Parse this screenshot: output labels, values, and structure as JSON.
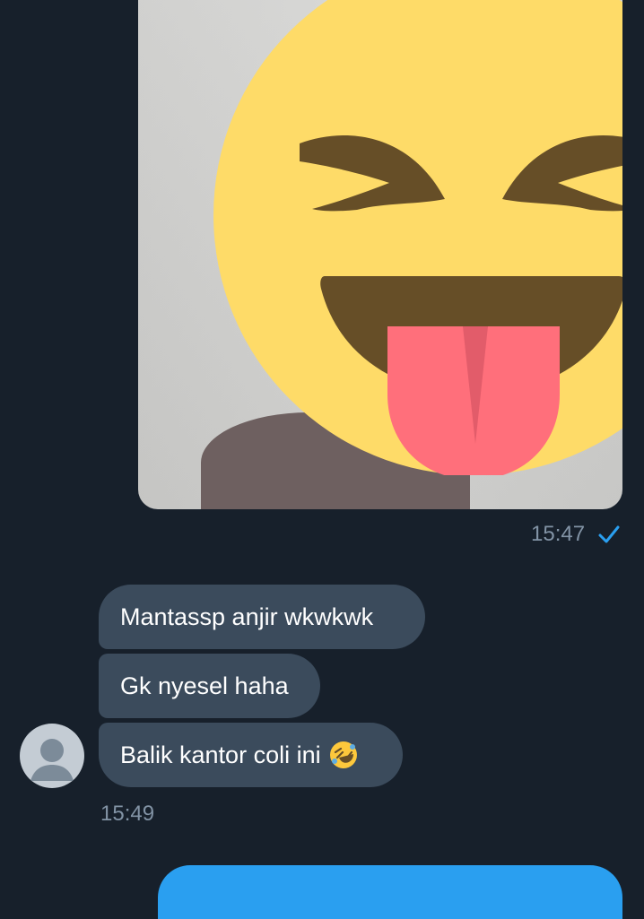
{
  "sent_media": {
    "overlay_icon": "grinning-squinting-tongue-emoji-icon",
    "timestamp": "15:47",
    "status_icon": "check-icon"
  },
  "received": {
    "avatar_icon": "person-avatar-icon",
    "messages": [
      {
        "text": "Mantassp anjir wkwkwk"
      },
      {
        "text": "Gk nyesel haha"
      },
      {
        "text": "Balik kantor coli ini",
        "emoji": "rolling-on-floor-laughing-icon"
      }
    ],
    "timestamp": "15:49"
  },
  "colors": {
    "background": "#17202b",
    "incoming_bubble": "#3b4b5c",
    "outgoing_bubble": "#2a9ff0",
    "timestamp": "#8293a5",
    "check": "#2a9ff0"
  }
}
